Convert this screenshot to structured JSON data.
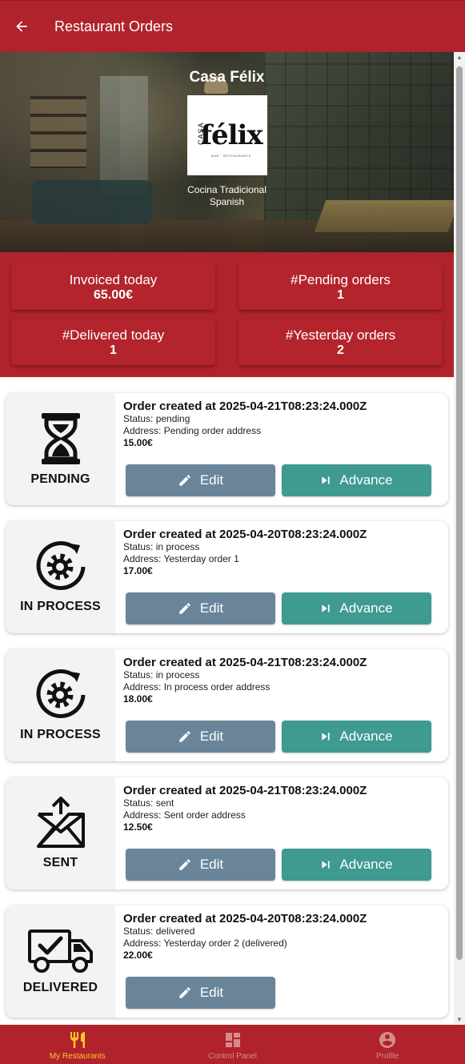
{
  "appbar": {
    "title": "Restaurant Orders",
    "back_icon": "arrow-back-icon"
  },
  "restaurant": {
    "name": "Casa Félix",
    "logo_casa": "CASA",
    "logo_text": "félix",
    "logo_subtitle": "BAR · RESTAURANTE",
    "cuisine": "Cocina Tradicional",
    "category": "Spanish"
  },
  "stats": [
    {
      "label": "Invoiced today",
      "value": "65.00€"
    },
    {
      "label": "#Pending orders",
      "value": "1"
    },
    {
      "label": "#Delivered today",
      "value": "1"
    },
    {
      "label": "#Yesterday orders",
      "value": "2"
    }
  ],
  "buttons": {
    "edit": "Edit",
    "advance": "Advance"
  },
  "orders": [
    {
      "icon": "hourglass-icon",
      "state": "PENDING",
      "title": "Order created at 2025-04-21T08:23:24.000Z",
      "status": "Status: pending",
      "address": "Address: Pending order address",
      "price": "15.00€",
      "advance": true
    },
    {
      "icon": "gear-process-icon",
      "state": "IN PROCESS",
      "title": "Order created at 2025-04-20T08:23:24.000Z",
      "status": "Status: in process",
      "address": "Address: Yesterday order 1",
      "price": "17.00€",
      "advance": true
    },
    {
      "icon": "gear-process-icon",
      "state": "IN PROCESS",
      "title": "Order created at 2025-04-21T08:23:24.000Z",
      "status": "Status: in process",
      "address": "Address: In process order address",
      "price": "18.00€",
      "advance": true
    },
    {
      "icon": "envelope-sent-icon",
      "state": "SENT",
      "title": "Order created at 2025-04-21T08:23:24.000Z",
      "status": "Status: sent",
      "address": "Address: Sent order address",
      "price": "12.50€",
      "advance": true
    },
    {
      "icon": "truck-check-icon",
      "state": "DELIVERED",
      "title": "Order created at 2025-04-20T08:23:24.000Z",
      "status": "Status: delivered",
      "address": "Address: Yesterday order 2 (delivered)",
      "price": "22.00€",
      "advance": false
    }
  ],
  "nav": [
    {
      "label": "My Restaurants",
      "icon": "fork-knife-icon",
      "active": true
    },
    {
      "label": "Control Panel",
      "icon": "dashboard-icon",
      "active": false
    },
    {
      "label": "Profile",
      "icon": "account-circle-icon",
      "active": false
    }
  ],
  "colors": {
    "primary": "#b0232c",
    "edit": "#6a8599",
    "advance": "#3f9a90",
    "nav_active": "#ffc629"
  }
}
